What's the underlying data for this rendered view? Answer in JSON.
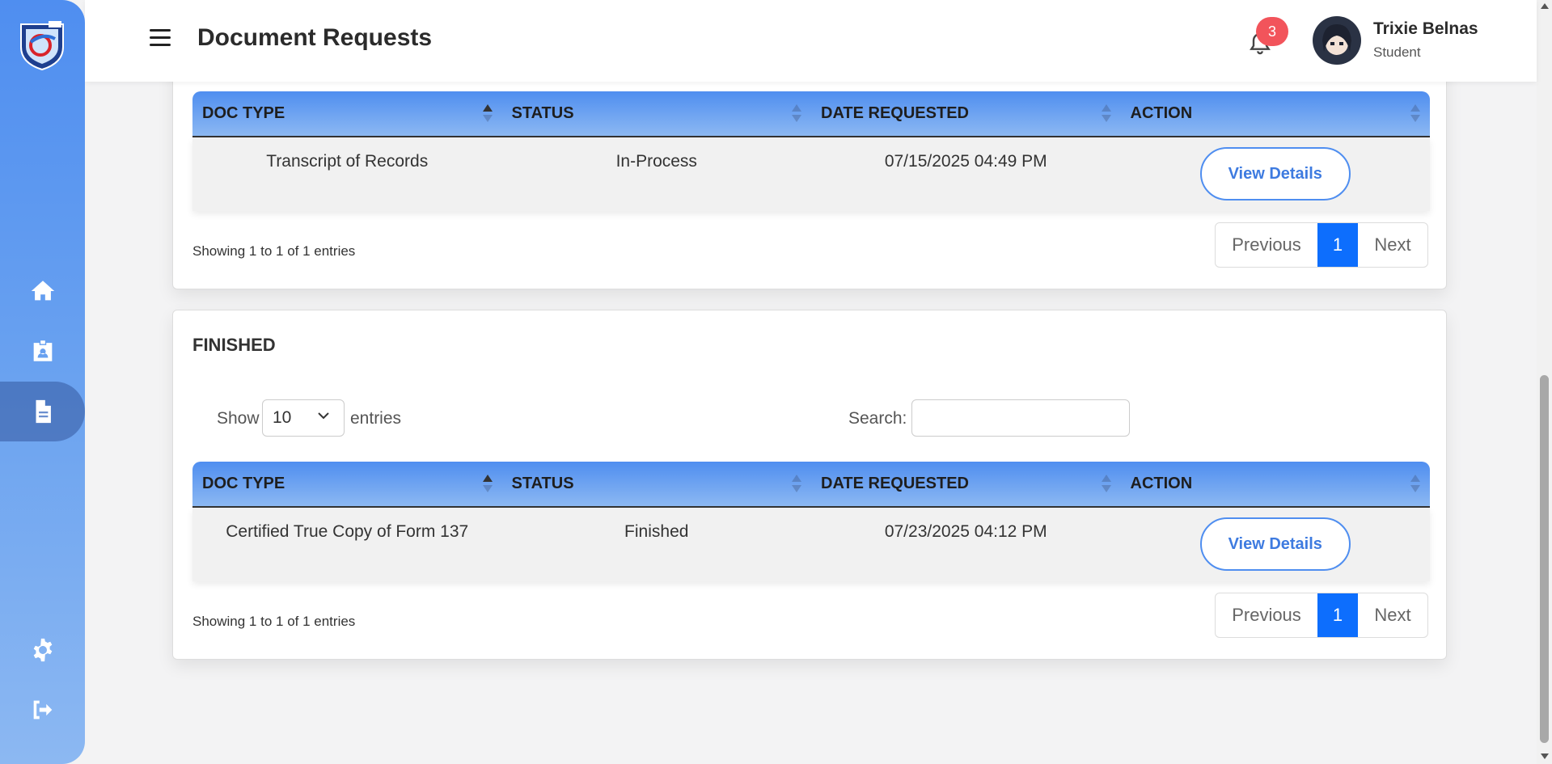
{
  "header": {
    "title": "Document Requests",
    "notification_count": "3",
    "user_name": "Trixie Belnas",
    "user_role": "Student"
  },
  "sidebar": {
    "items": [
      {
        "icon": "home-icon"
      },
      {
        "icon": "id-badge-icon"
      },
      {
        "icon": "document-icon",
        "active": true
      },
      {
        "icon": "gear-icon"
      },
      {
        "icon": "logout-icon"
      }
    ]
  },
  "columns": [
    "DOC TYPE",
    "STATUS",
    "DATE REQUESTED",
    "ACTION"
  ],
  "in_process": {
    "rows": [
      {
        "doc_type": "Transcript of Records",
        "status": "In-Process",
        "date": "07/15/2025 04:49 PM",
        "action": "View Details"
      }
    ],
    "showing": "Showing 1 to 1 of 1 entries",
    "pager": {
      "prev": "Previous",
      "current": "1",
      "next": "Next"
    }
  },
  "finished": {
    "title": "FINISHED",
    "show_label": "Show",
    "length_value": "10",
    "entries_label": "entries",
    "search_label": "Search:",
    "search_value": "",
    "rows": [
      {
        "doc_type": "Certified True Copy of Form 137",
        "status": "Finished",
        "date": "07/23/2025 04:12 PM",
        "action": "View Details"
      }
    ],
    "showing": "Showing 1 to 1 of 1 entries",
    "pager": {
      "prev": "Previous",
      "current": "1",
      "next": "Next"
    }
  },
  "colors": {
    "accent": "#4f8ef0",
    "pager_active": "#0d6efd",
    "badge": "#f2545b"
  }
}
